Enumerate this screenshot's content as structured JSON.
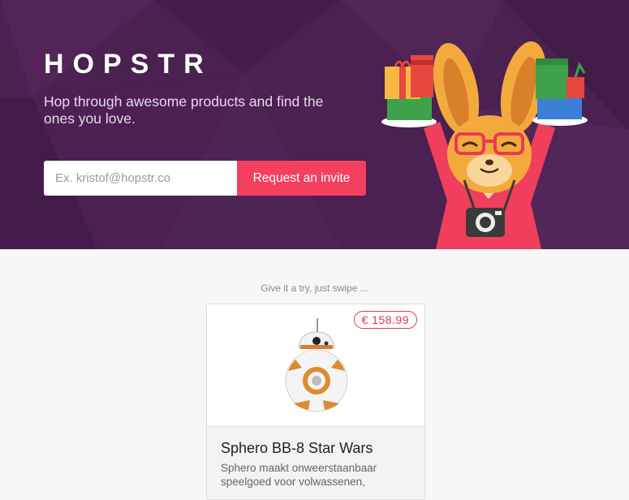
{
  "header": {
    "logo": "HOPSTR",
    "tagline": "Hop through awesome products and find the ones you love."
  },
  "signup": {
    "email_placeholder": "Ex. kristof@hopstr.co",
    "email_value": "",
    "button_label": "Request an invite"
  },
  "hint": "Give it a try, just swipe ...",
  "product": {
    "price": "€ 158.99",
    "title": "Sphero BB-8 Star Wars",
    "description": "Sphero maakt onweerstaanbaar speelgoed voor volwassenen,"
  },
  "icons": {
    "mascot": "bunny-mascot-illustration",
    "camera": "camera-icon",
    "product": "bb8-robot-image"
  },
  "colors": {
    "hero_bg": "#4a2150",
    "accent": "#f43f5e",
    "price": "#e2344f"
  }
}
